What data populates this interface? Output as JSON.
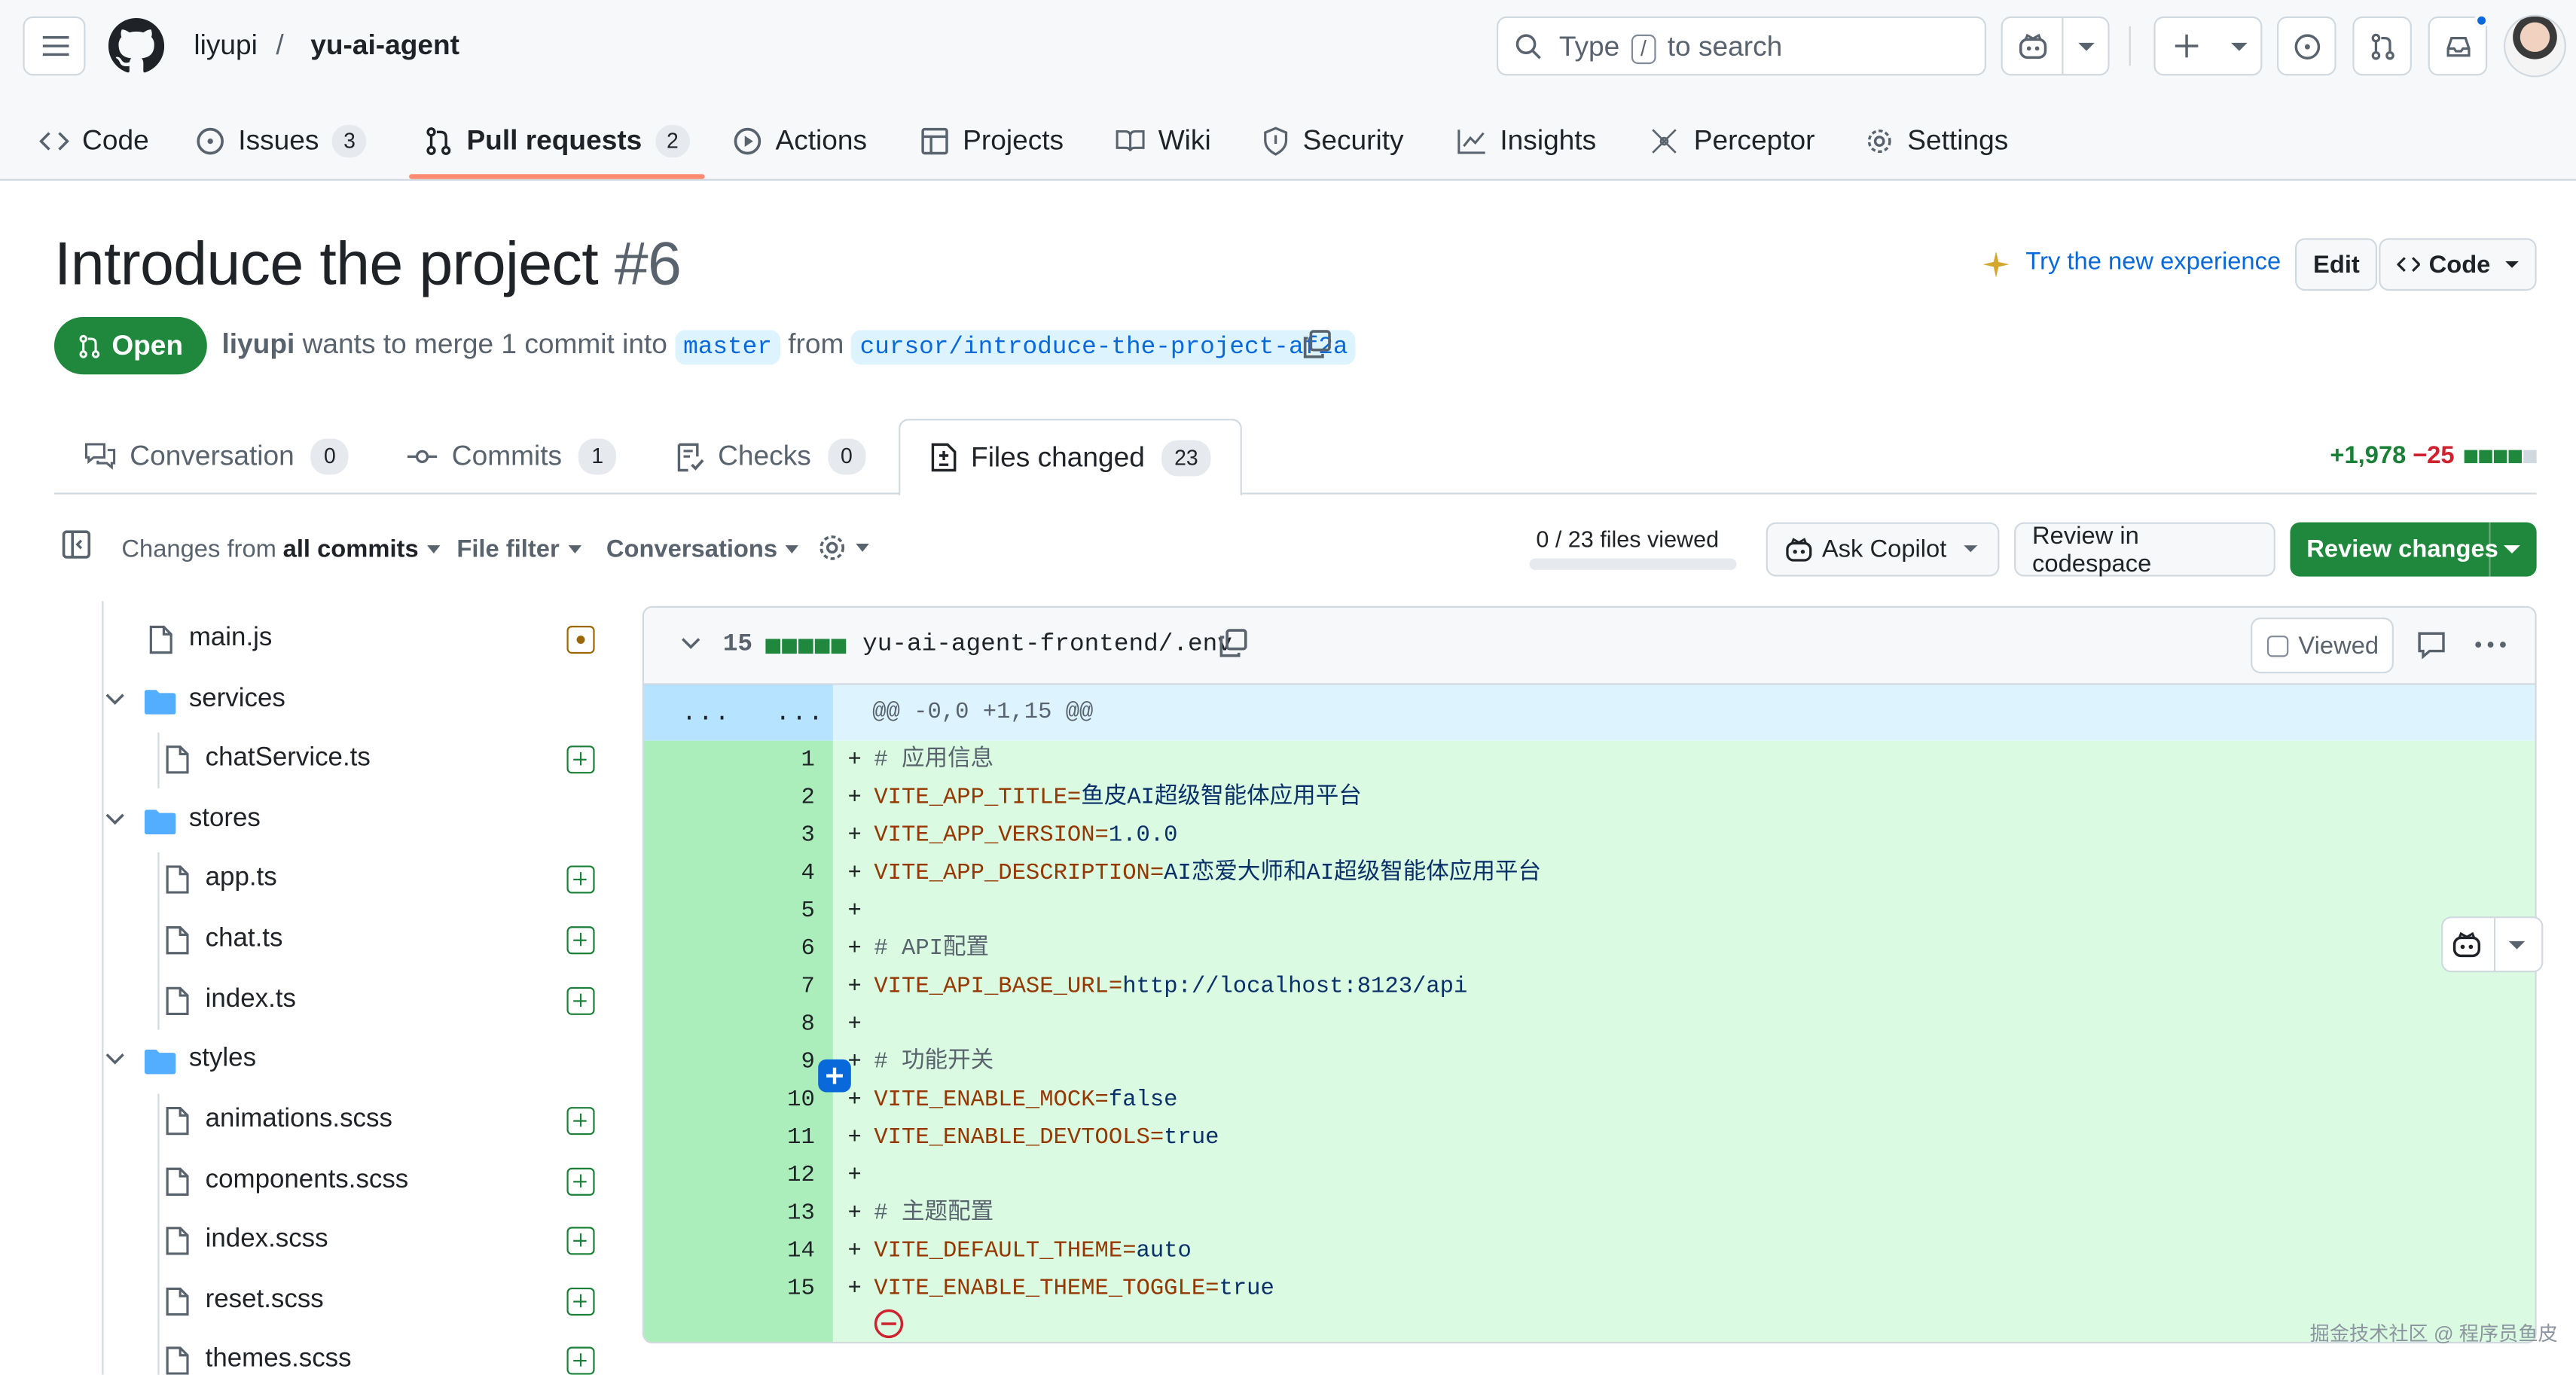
{
  "header": {
    "owner": "liyupi",
    "separator": "/",
    "repo": "yu-ai-agent",
    "search_prefix": "Type",
    "search_key": "/",
    "search_suffix": "to search"
  },
  "repo_tabs": [
    {
      "label": "Code"
    },
    {
      "label": "Issues",
      "count": "3"
    },
    {
      "label": "Pull requests",
      "count": "2"
    },
    {
      "label": "Actions"
    },
    {
      "label": "Projects"
    },
    {
      "label": "Wiki"
    },
    {
      "label": "Security"
    },
    {
      "label": "Insights"
    },
    {
      "label": "Perceptor"
    },
    {
      "label": "Settings"
    }
  ],
  "pr": {
    "title": "Introduce the project",
    "number": "#6",
    "try_new": "Try the new experience",
    "edit_label": "Edit",
    "code_label": "Code",
    "state": "Open",
    "author": "liyupi",
    "merge_phrase": "wants to merge 1 commit into",
    "base_branch": "master",
    "from_word": "from",
    "head_branch": "cursor/introduce-the-project-af2a"
  },
  "pr_tabs": [
    {
      "label": "Conversation",
      "count": "0"
    },
    {
      "label": "Commits",
      "count": "1"
    },
    {
      "label": "Checks",
      "count": "0"
    },
    {
      "label": "Files changed",
      "count": "23"
    }
  ],
  "diffstat": {
    "additions": "+1,978",
    "deletions": "−25"
  },
  "toolbar": {
    "changes_from": "Changes from",
    "changes_value": "all commits",
    "file_filter": "File filter",
    "conversations": "Conversations",
    "files_viewed": "0 / 23 files viewed",
    "files_viewed_fraction": 0,
    "ask_copilot": "Ask Copilot",
    "review_codespace": "Review in codespace",
    "review_changes": "Review changes"
  },
  "file_tree": [
    {
      "name": "main.js",
      "type": "file",
      "status": "modified"
    },
    {
      "name": "services",
      "type": "folder"
    },
    {
      "name": "chatService.ts",
      "type": "file",
      "status": "added"
    },
    {
      "name": "stores",
      "type": "folder"
    },
    {
      "name": "app.ts",
      "type": "file",
      "status": "added"
    },
    {
      "name": "chat.ts",
      "type": "file",
      "status": "added"
    },
    {
      "name": "index.ts",
      "type": "file",
      "status": "added"
    },
    {
      "name": "styles",
      "type": "folder"
    },
    {
      "name": "animations.scss",
      "type": "file",
      "status": "added"
    },
    {
      "name": "components.scss",
      "type": "file",
      "status": "added"
    },
    {
      "name": "index.scss",
      "type": "file",
      "status": "added"
    },
    {
      "name": "reset.scss",
      "type": "file",
      "status": "added"
    },
    {
      "name": "themes.scss",
      "type": "file",
      "status": "added"
    }
  ],
  "diff": {
    "changed_lines": "15",
    "filename": "yu-ai-agent-frontend/.env",
    "viewed_label": "Viewed",
    "hunk_dots": "...",
    "hunk_header": "@@ -0,0 +1,15 @@",
    "lines": [
      {
        "n": "1",
        "comment": "# 应用信息"
      },
      {
        "n": "2",
        "key": "VITE_APP_TITLE=",
        "value": "鱼皮AI超级智能体应用平台"
      },
      {
        "n": "3",
        "key": "VITE_APP_VERSION=",
        "value": "1.0.0"
      },
      {
        "n": "4",
        "key": "VITE_APP_DESCRIPTION=",
        "value": "AI恋爱大师和AI超级智能体应用平台"
      },
      {
        "n": "5"
      },
      {
        "n": "6",
        "comment": "# API配置"
      },
      {
        "n": "7",
        "key": "VITE_API_BASE_URL=",
        "value": "http://localhost:8123/api"
      },
      {
        "n": "8"
      },
      {
        "n": "9",
        "comment": "# 功能开关"
      },
      {
        "n": "10",
        "key": "VITE_ENABLE_MOCK=",
        "value": "false"
      },
      {
        "n": "11",
        "key": "VITE_ENABLE_DEVTOOLS=",
        "value": "true"
      },
      {
        "n": "12"
      },
      {
        "n": "13",
        "comment": "# 主题配置"
      },
      {
        "n": "14",
        "key": "VITE_DEFAULT_THEME=",
        "value": "auto"
      },
      {
        "n": "15",
        "key": "VITE_ENABLE_THEME_TOGGLE=",
        "value": "true"
      }
    ]
  },
  "watermark": "掘金技术社区 @ 程序员鱼皮",
  "colors": {
    "accent": "#0969da",
    "green": "#1f883d",
    "tab_underline": "#fd8c73"
  }
}
